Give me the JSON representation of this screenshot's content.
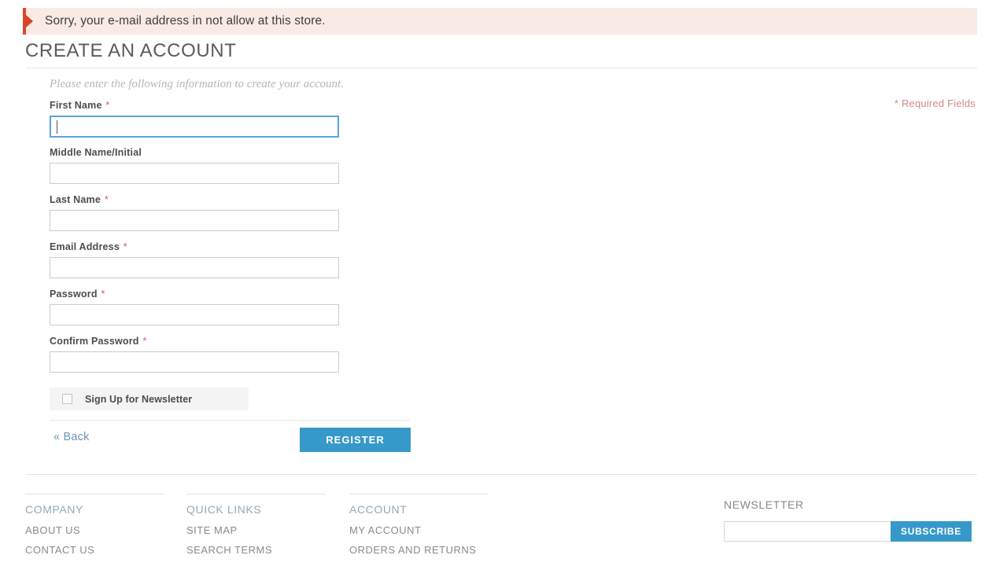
{
  "error": {
    "message": "Sorry, your e-mail address in not allow at this store.",
    "marker_color": "#d9472b",
    "background_color": "#faeae6"
  },
  "page": {
    "title": "CREATE AN ACCOUNT",
    "intro": "Please enter the following information to create your account.",
    "required_note": "* Required Fields"
  },
  "form": {
    "required_star": "*",
    "fields": [
      {
        "label": "First Name",
        "required": true,
        "value": "",
        "placeholder": "",
        "focused": true
      },
      {
        "label": "Middle Name/Initial",
        "required": false,
        "value": "",
        "placeholder": "",
        "focused": false
      },
      {
        "label": "Last Name",
        "required": true,
        "value": "",
        "placeholder": "",
        "focused": false
      },
      {
        "label": "Email Address",
        "required": true,
        "value": "",
        "placeholder": "",
        "focused": false
      },
      {
        "label": "Password",
        "required": true,
        "value": "",
        "placeholder": "",
        "focused": false
      },
      {
        "label": "Confirm Password",
        "required": true,
        "value": "",
        "placeholder": "",
        "focused": false
      }
    ],
    "newsletter": {
      "label": "Sign Up for Newsletter",
      "checked": false
    },
    "back_label": "« Back",
    "register_label": "REGISTER",
    "accent_color": "#3699c9"
  },
  "footer": {
    "columns": [
      {
        "heading": "COMPANY",
        "links": [
          "ABOUT US",
          "CONTACT US"
        ]
      },
      {
        "heading": "QUICK LINKS",
        "links": [
          "SITE MAP",
          "SEARCH TERMS"
        ]
      },
      {
        "heading": "ACCOUNT",
        "links": [
          "MY ACCOUNT",
          "ORDERS AND RETURNS"
        ]
      }
    ],
    "newsletter": {
      "heading": "NEWSLETTER",
      "input_value": "",
      "input_placeholder": "",
      "subscribe_label": "SUBSCRIBE"
    }
  }
}
